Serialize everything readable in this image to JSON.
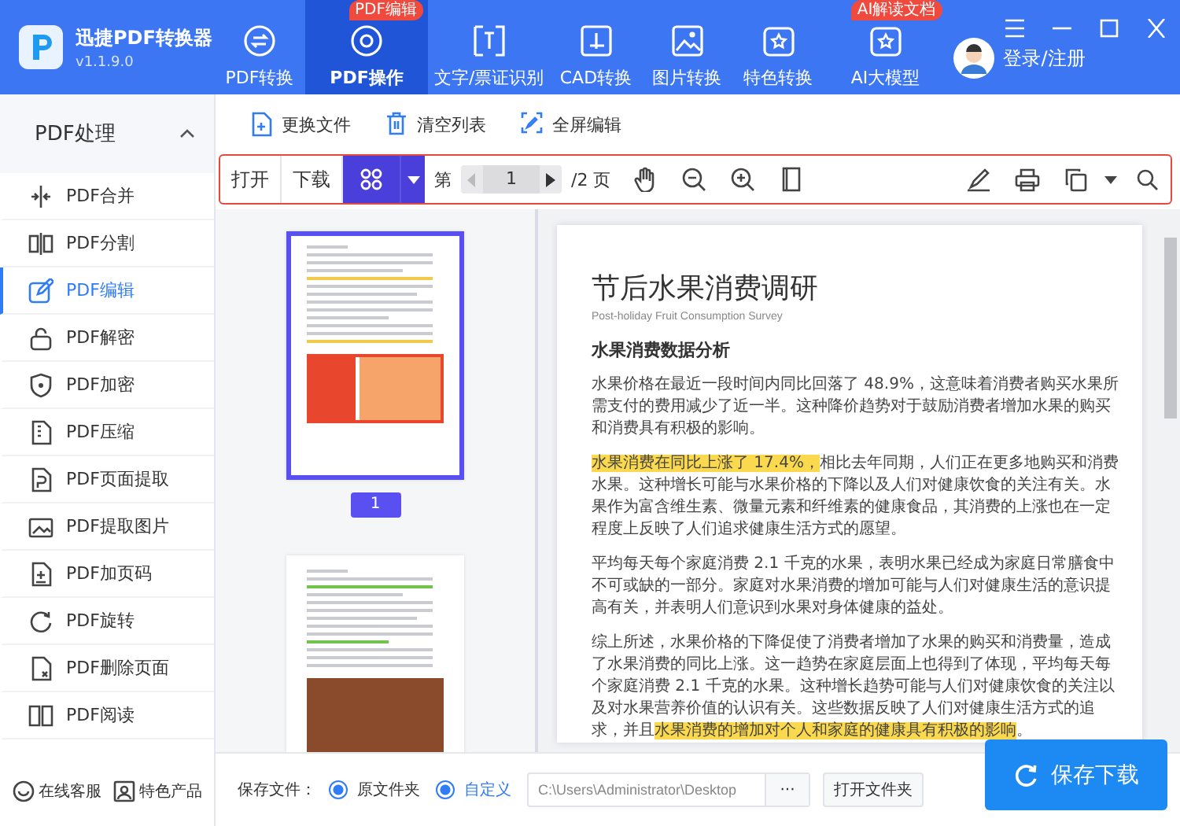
{
  "window": {
    "app_name": "迅捷PDF转换器",
    "version": "v1.1.9.0"
  },
  "tabs": [
    {
      "label": "PDF转换",
      "selected": false
    },
    {
      "label": "PDF操作",
      "selected": true,
      "badge": "PDF编辑"
    },
    {
      "label": "文字/票证识别",
      "selected": false
    },
    {
      "label": "CAD转换",
      "selected": false
    },
    {
      "label": "图片转换",
      "selected": false
    },
    {
      "label": "特色转换",
      "selected": false
    },
    {
      "label": "AI大模型",
      "selected": false,
      "badge": "AI解读文档"
    }
  ],
  "account": {
    "label": "登录/注册"
  },
  "sidebar": {
    "title": "PDF处理",
    "expanded": true,
    "items": [
      {
        "label": "PDF合并",
        "selected": false
      },
      {
        "label": "PDF分割",
        "selected": false
      },
      {
        "label": "PDF编辑",
        "selected": true
      },
      {
        "label": "PDF解密",
        "selected": false
      },
      {
        "label": "PDF加密",
        "selected": false
      },
      {
        "label": "PDF压缩",
        "selected": false
      },
      {
        "label": "PDF页面提取",
        "selected": false
      },
      {
        "label": "PDF提取图片",
        "selected": false
      },
      {
        "label": "PDF加页码",
        "selected": false
      },
      {
        "label": "PDF旋转",
        "selected": false
      },
      {
        "label": "PDF删除页面",
        "selected": false
      },
      {
        "label": "PDF阅读",
        "selected": false
      }
    ],
    "footer": [
      "在线客服",
      "特色产品"
    ]
  },
  "file_toolbar": [
    "更换文件",
    "清空列表",
    "全屏编辑"
  ],
  "viewer_toolbar": {
    "open": "打开",
    "download": "下载",
    "page_prefix": "第",
    "page": "1",
    "page_total": "/2 页"
  },
  "thumbnails": [
    {
      "label": "1",
      "selected": true
    },
    {
      "selected": false
    }
  ],
  "document": {
    "title": "节后水果消费调研",
    "subtitle": "Post-holiday Fruit Consumption Survey",
    "heading": "水果消费数据分析",
    "paragraphs": [
      [
        {
          "text": "水果价格在最近一段时间内同比回落了 48.9%，这意味着消费者购买水果所需支付的费用减少了近一半。这种降价趋势对于鼓励消费者增加水果的购买和消费具有积极的影响。",
          "highlight": false
        }
      ],
      [
        {
          "text": "水果消费在同比上涨了 17.4%，",
          "highlight": true
        },
        {
          "text": "相比去年同期，人们正在更多地购买和消费水果。这种增长可能与水果价格的下降以及人们对健康饮食的关注有关。水果作为富含维生素、微量元素和纤维素的健康食品，其消费的上涨也在一定程度上反映了人们追求健康生活方式的愿望。",
          "highlight": false
        }
      ],
      [
        {
          "text": "平均每天每个家庭消费 2.1 千克的水果，表明水果已经成为家庭日常膳食中不可或缺的一部分。家庭对水果消费的增加可能与人们对健康生活的意识提高有关，并表明人们意识到水果对身体健康的益处。",
          "highlight": false
        }
      ],
      [
        {
          "text": "综上所述，水果价格的下降促使了消费者增加了水果的购买和消费量，造成了水果消费的同比上涨。这一趋势在家庭层面上也得到了体现，平均每天每个家庭消费 2.1 千克的水果。这种增长趋势可能与人们对健康饮食的关注以及对水果营养价值的认识有关。这些数据反映了人们对健康生活方式的追求，并且",
          "highlight": false
        },
        {
          "text": "水果消费的增加对个人和家庭的健康具有积极的影响",
          "highlight": true
        },
        {
          "text": "。",
          "highlight": false
        }
      ]
    ]
  },
  "save_bar": {
    "label": "保存文件：",
    "options": [
      {
        "label": "原文件夹",
        "selected": true,
        "highlight": false
      },
      {
        "label": "自定义",
        "selected": true,
        "highlight": true
      }
    ],
    "path": "C:\\Users\\Administrator\\Desktop",
    "browse": "···",
    "open_folder": "打开文件夹",
    "save_button": "保存下载"
  }
}
